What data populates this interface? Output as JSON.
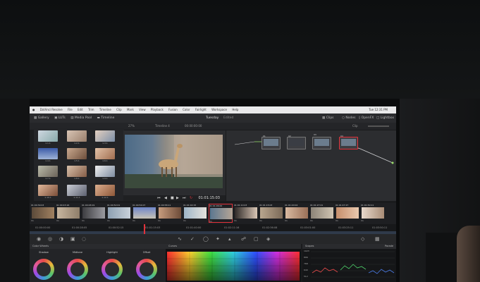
{
  "menubar": {
    "items": [
      "DaVinci Resolve",
      "File",
      "Edit",
      "Trim",
      "Timeline",
      "Clip",
      "Mark",
      "View",
      "Playback",
      "Fusion",
      "Color",
      "Fairlight",
      "Workspace",
      "Help"
    ],
    "clock": "Tue 12:31 PM"
  },
  "toolbar": {
    "gallery": "Gallery",
    "luts": "LUTs",
    "media_pool": "Media Pool",
    "timeline": "Timeline",
    "project": "Tuesday",
    "edited": "Edited",
    "clips": "Clips",
    "nodes": "Nodes",
    "openfx": "OpenFX",
    "lightbox": "Lightbox"
  },
  "subbar": {
    "zoom": "27%",
    "timeline_name": "Timeline 4",
    "viewer_timecode": "00:00:00:00",
    "clip_label": "Clip"
  },
  "gallery_stills": [
    "1.1.1",
    "1.2.1",
    "1.3.1",
    "1.4.1",
    "1.5.1",
    "1.6.1",
    "1.7.1",
    "1.8.1",
    "1.9.1",
    "1.10.1",
    "1.11.1",
    "1.12.1"
  ],
  "viewer": {
    "timecode": "01:01:15:03"
  },
  "nodes": {
    "labels": [
      "01",
      "02",
      "03",
      "04"
    ]
  },
  "clips": [
    {
      "tc": "01:00:39:03",
      "name": "V1"
    },
    {
      "tc": "01:00:43:16",
      "name": "V1"
    },
    {
      "tc": "01:00:48:19",
      "name": "V1"
    },
    {
      "tc": "01:00:52:01",
      "name": "V1"
    },
    {
      "tc": "01:00:54:07",
      "name": "V1"
    },
    {
      "tc": "01:00:58:11",
      "name": "V1"
    },
    {
      "tc": "01:01:02:15",
      "name": "V1"
    },
    {
      "tc": "01:01:06:00",
      "name": "V1"
    },
    {
      "tc": "01:01:10:23",
      "name": "V1"
    },
    {
      "tc": "01:01:15:03",
      "name": "V1"
    },
    {
      "tc": "01:01:20:04",
      "name": "V1"
    },
    {
      "tc": "01:01:27:21",
      "name": "V1"
    },
    {
      "tc": "01:01:47:27",
      "name": "V1"
    },
    {
      "tc": "01:01:50:11",
      "name": "V1"
    }
  ],
  "ruler": [
    "01:00:00:00",
    "01:00:28:05",
    "01:00:52:15",
    "01:01:15:03",
    "01:01:40:00",
    "01:02:11:16",
    "01:02:36:08",
    "01:03:01:00",
    "01:03:25:11",
    "01:03:50:11"
  ],
  "panels": {
    "color_wheels": "Color Wheels",
    "curves": "Curves",
    "scopes": "Scopes",
    "parade": "Parade"
  },
  "wheels": [
    {
      "label": "Shadow",
      "color": "#3b9bd6"
    },
    {
      "label": "Midtone",
      "color": "#e25a9a"
    },
    {
      "label": "Highlight",
      "color": "#e6b93a"
    },
    {
      "label": "Offset",
      "color": "#5ac36a"
    }
  ],
  "scope_scale": [
    "1023",
    "896",
    "768",
    "640",
    "512"
  ],
  "colors": {
    "playhead": "#e3323b",
    "trace_red": "#e74a4a",
    "trace_green": "#4fd36b",
    "trace_blue": "#4a7be7"
  }
}
